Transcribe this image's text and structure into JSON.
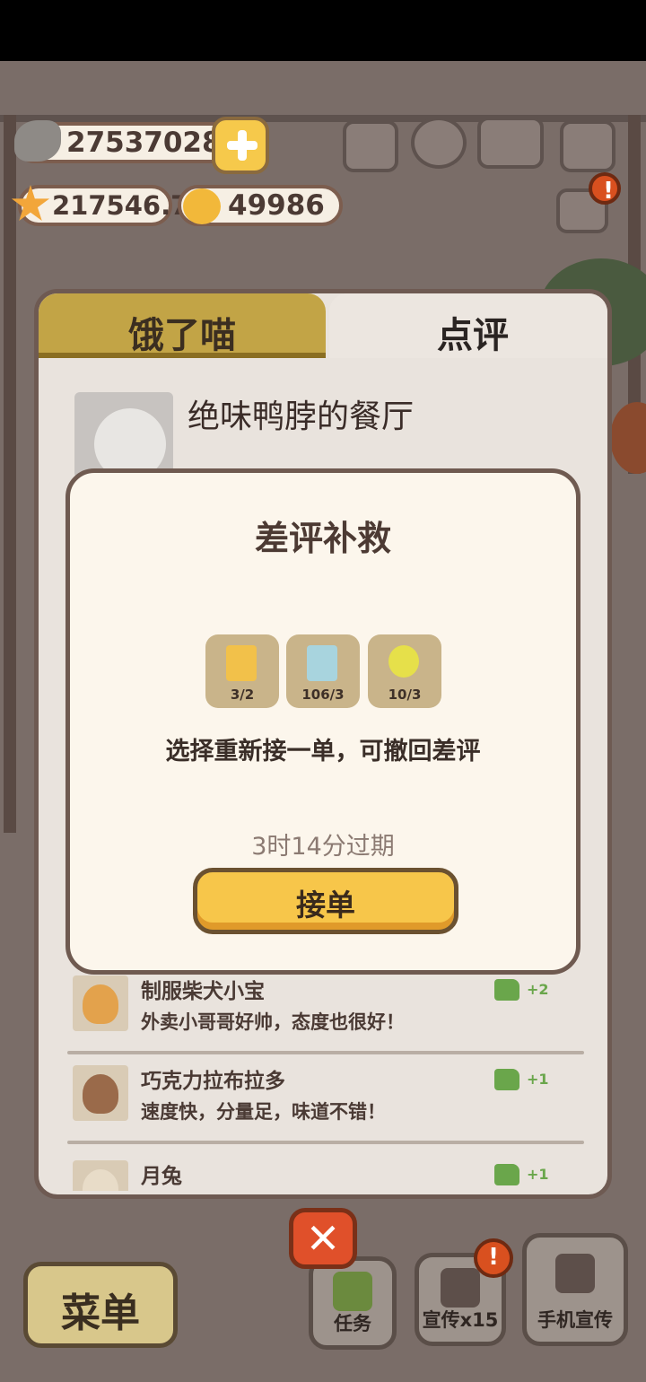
{
  "currencies": {
    "fish": "275370280",
    "stars": "217546.7",
    "bells": "49986"
  },
  "tabs": {
    "hungry_cat": "饿了喵",
    "review": "点评"
  },
  "restaurant": {
    "name": "绝味鸭脖的餐厅"
  },
  "reviews": [
    {
      "name": "制服柴犬小宝",
      "text": "外卖小哥哥好帅，态度也很好！",
      "likes": "+2"
    },
    {
      "name": "巧克力拉布拉多",
      "text": "速度快，分量足，味道不错！",
      "likes": "+1"
    },
    {
      "name": "月兔",
      "text": "",
      "likes": "+1"
    }
  ],
  "modal": {
    "title": "差评补救",
    "items": [
      {
        "icon": "juice-carton-icon",
        "count": "3/2"
      },
      {
        "icon": "milk-carton-icon",
        "count": "106/3"
      },
      {
        "icon": "apple-icon",
        "count": "10/3"
      }
    ],
    "description": "选择重新接一单，可撤回差评",
    "expire": "3时14分过期",
    "accept_label": "接单"
  },
  "bottom_bar": {
    "menu": "菜单",
    "tasks": "任务",
    "promote": "宣传x15",
    "phone_promote": "手机宣传"
  },
  "colors": {
    "accent_yellow": "#f7c64a",
    "tab_gold": "#c2a446",
    "like_green": "#6aa64b",
    "close_red": "#e0502a"
  }
}
